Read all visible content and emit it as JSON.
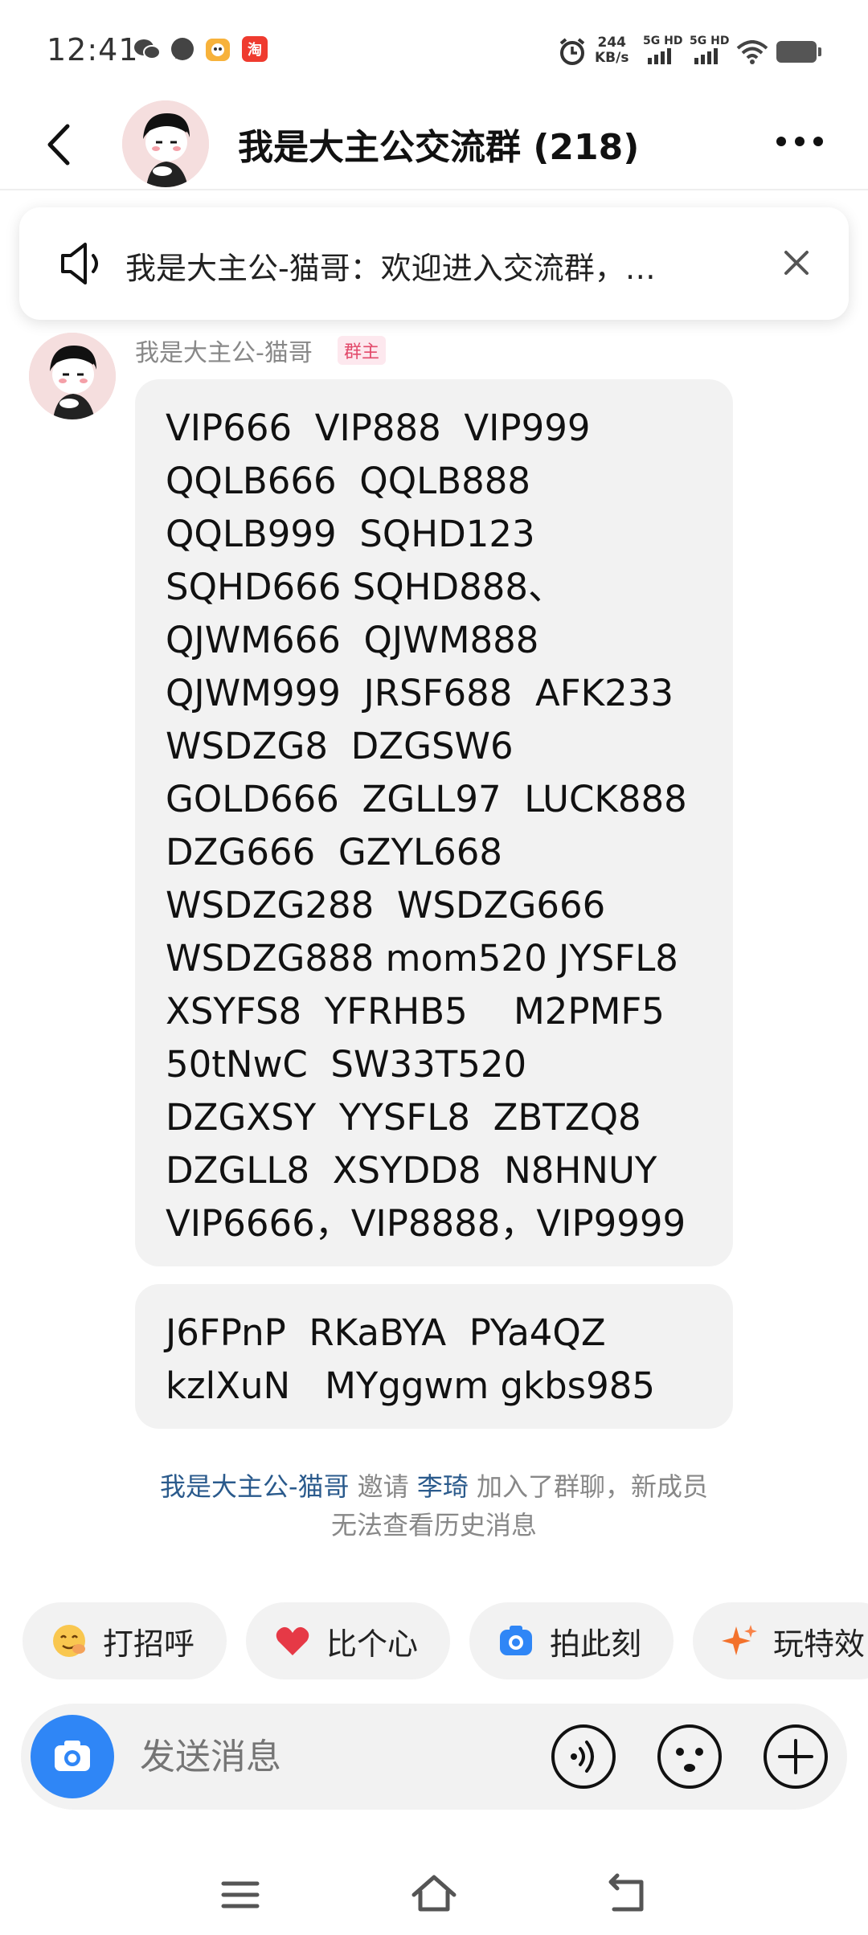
{
  "status_bar": {
    "time": "12:41",
    "net_speed_value": "244",
    "net_speed_unit": "KB/s",
    "sim1": "5G HD",
    "sim2": "5G HD"
  },
  "header": {
    "title": "我是大主公交流群 (218)"
  },
  "notice": {
    "text": "我是大主公-猫哥：欢迎进入交流群，…"
  },
  "message": {
    "sender": "我是大主公-猫哥",
    "role": "群主",
    "bubble1_lines": [
      "VIP666  VIP888  VIP999",
      "QQLB666  QQLB888",
      "QQLB999  SQHD123",
      "SQHD666 SQHD888、",
      "QJWM666  QJWM888",
      "QJWM999  JRSF688  AFK233",
      "WSDZG8  DZGSW6",
      "GOLD666  ZGLL97  LUCK888",
      "DZG666  GZYL668",
      "WSDZG288  WSDZG666",
      "WSDZG888 mom520 JYSFL8",
      "XSYFS8  YFRHB5    M2PMF5",
      "50tNwC  SW33T520",
      "DZGXSY  YYSFL8  ZBTZQ8",
      "DZGLL8  XSYDD8  N8HNUY",
      "VIP6666，VIP8888，VIP9999"
    ],
    "bubble2_lines": [
      "J6FPnP  RKaBYA  PYa4QZ",
      "kzlXuN   MYggwm gkbs985"
    ]
  },
  "system_message": {
    "inviter": "我是大主公-猫哥",
    "verb": " 邀请 ",
    "invitee": "李琦",
    "tail": " 加入了群聊，新成员",
    "line2": "无法查看历史消息"
  },
  "quick_actions": [
    {
      "label": "打招呼",
      "icon": "wave-emoji-icon"
    },
    {
      "label": "比个心",
      "icon": "heart-icon"
    },
    {
      "label": "拍此刻",
      "icon": "camera-icon"
    },
    {
      "label": "玩特效",
      "icon": "sparkle-icon"
    }
  ],
  "input": {
    "placeholder": "发送消息"
  },
  "colors": {
    "accent_blue": "#2f86f6",
    "link_blue": "#2a5a8c",
    "owner_badge": "#e24a6b"
  }
}
